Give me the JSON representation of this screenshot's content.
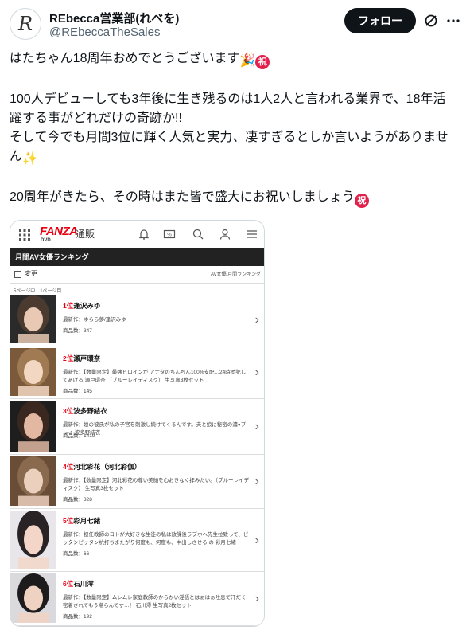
{
  "author": {
    "avatar_letter": "R",
    "display_name": "REbecca営業部(れべを)",
    "handle": "@REbeccaTheSales"
  },
  "actions": {
    "follow_label": "フォロー"
  },
  "tweet": {
    "line1": "はたちゃん18周年おめでとうございます",
    "line1_emoji": "🎉",
    "iwai_glyph": "祝",
    "line2": "100人デビューしても3年後に生き残るのは1人2人と言われる業界で、18年活躍する事がどれだけの奇跡か!!",
    "line3": "そして今でも月間3位に輝く人気と実力、凄すぎるとしか言いようがありません",
    "line3_emoji": "✨",
    "line4": "20周年がきたら、その時はまた皆で盛大にお祝いしましょう"
  },
  "fanza": {
    "logo": "FANZA",
    "logo_sub": "DVD",
    "shop_label": "通販",
    "section_title": "月間AV女優ランキング",
    "filter_label": "変更",
    "breadcrumb": "AV女優/月間ランキング",
    "page_info": "5ページ中　1ページ目",
    "rows": [
      {
        "rank": "1位",
        "name": "逢沢みゆ",
        "work": "最新作：ゆらら夢/逢沢みゆ",
        "count": "商品数：347"
      },
      {
        "rank": "2位",
        "name": "瀬戸環奈",
        "work": "最新作：【数量限定】最強ヒロインが アナタのちんちん100%支配…24時間犯してあげる 瀬戸環奈 （ブルーレイディスク） 生写真3枚セット",
        "count": "商品数：145"
      },
      {
        "rank": "3位",
        "name": "波多野結衣",
        "work": "最新作：娘の彼氏が私の子宮を刺激し続けてくるんです。夫と娘に秘密の濃●プレイ 波多野結衣",
        "count": "商品数：1419"
      },
      {
        "rank": "4位",
        "name": "河北彩花（河北彩伽）",
        "work": "最新作：【数量限定】河北彩花の尊い美顔を心おきなく拝みたい。（ブルーレイディスク） 生写真3枚セット",
        "count": "商品数：328"
      },
      {
        "rank": "5位",
        "name": "彩月七緒",
        "work": "最新作：担任教師のコトが大好きな生徒の私は放課後ラブホへ先生拉致って、ピッタンピッタン杭打ちまたがり何度も、何度も、中出しさせる の 彩月七緒",
        "count": "商品数：66"
      },
      {
        "rank": "6位",
        "name": "石川澪",
        "work": "最新作：【数量限定】ムレムレ家庭教師のからかい淫語とはぁはぁ吐息で汗だく密着されてもう堪らんです…！ 石川澪 生写真2枚セット",
        "count": "商品数：192"
      }
    ]
  },
  "colors": {
    "follow_bg": "#0f1419",
    "rank_red": "#e60012",
    "iwai_red": "#e2204b",
    "bar_dark": "#222222"
  }
}
